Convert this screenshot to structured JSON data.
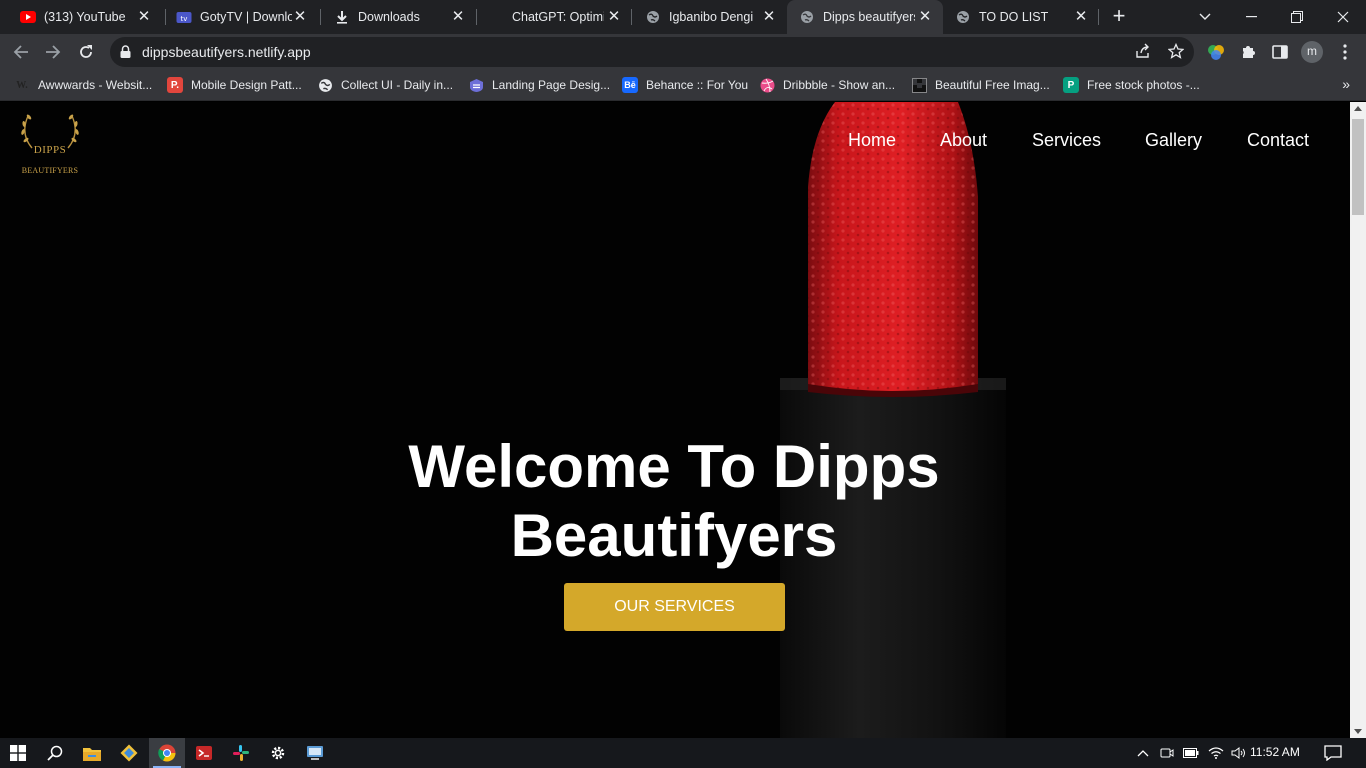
{
  "browser": {
    "tabs": [
      {
        "title": "(313) YouTube",
        "icon": "youtube-icon"
      },
      {
        "title": "GotyTV | Download",
        "icon": "gotytv-icon"
      },
      {
        "title": "Downloads",
        "icon": "download-icon"
      },
      {
        "title": "ChatGPT: Optimize",
        "icon": "chatgpt-icon"
      },
      {
        "title": "Igbanibo Dengi",
        "icon": "globe-icon"
      },
      {
        "title": "Dipps beautifyers",
        "icon": "globe-icon"
      },
      {
        "title": "TO DO LIST",
        "icon": "globe-icon"
      }
    ],
    "url": "dippsbeautifyers.netlify.app",
    "profile_initial": "m",
    "bookmarks": [
      {
        "label": "Awwwards - Websit...",
        "icon": "awwwards-icon",
        "badge": "W."
      },
      {
        "label": "Mobile Design Patt...",
        "icon": "pttrns-icon",
        "badge": "P."
      },
      {
        "label": "Collect UI - Daily in...",
        "icon": "globe-icon",
        "badge": ""
      },
      {
        "label": "Landing Page Desig...",
        "icon": "landbook-icon",
        "badge": ""
      },
      {
        "label": "Behance :: For You",
        "icon": "behance-icon",
        "badge": "Bē"
      },
      {
        "label": "Dribbble - Show an...",
        "icon": "dribbble-icon",
        "badge": ""
      },
      {
        "label": "Beautiful Free Imag...",
        "icon": "unsplash-icon",
        "badge": ""
      },
      {
        "label": "Free stock photos -...",
        "icon": "pexels-icon",
        "badge": "P"
      }
    ]
  },
  "site": {
    "logo": {
      "line1": "DIPPS",
      "line2": "BEAUTIFYERS"
    },
    "nav": [
      "Home",
      "About",
      "Services",
      "Gallery",
      "Contact"
    ],
    "hero": {
      "title_line1": "Welcome To Dipps",
      "title_line2": "Beautifyers",
      "cta": "OUR SERVICES"
    },
    "colors": {
      "accent": "#d4a82a",
      "lipstick": "#c8161b",
      "background": "#020202"
    }
  },
  "taskbar": {
    "apps": [
      "start-icon",
      "search-icon",
      "file-explorer-icon",
      "git-icon",
      "chrome-icon",
      "terminal-icon",
      "slack-icon",
      "settings-icon",
      "remote-desktop-icon"
    ],
    "time": "11:52 AM"
  }
}
